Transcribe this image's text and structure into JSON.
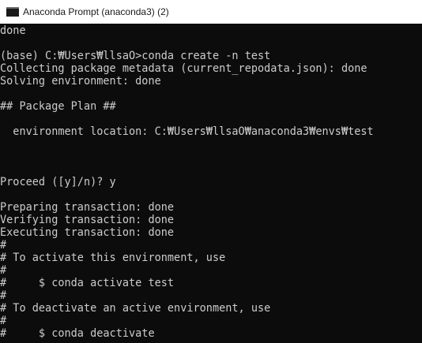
{
  "window": {
    "title": "Anaconda Prompt (anaconda3) (2)",
    "icon": "console-window-icon"
  },
  "console": {
    "colors": {
      "background": "#0c0c0c",
      "text": "#cccccc"
    },
    "lines": [
      "done",
      "",
      "(base) C:₩Users₩llsaO>conda create -n test",
      "Collecting package metadata (current_repodata.json): done",
      "Solving environment: done",
      "",
      "## Package Plan ##",
      "",
      "  environment location: C:₩Users₩llsaO₩anaconda3₩envs₩test",
      "",
      "",
      "",
      "Proceed ([y]/n)? y",
      "",
      "Preparing transaction: done",
      "Verifying transaction: done",
      "Executing transaction: done",
      "#",
      "# To activate this environment, use",
      "#",
      "#     $ conda activate test",
      "#",
      "# To deactivate an active environment, use",
      "#",
      "#     $ conda deactivate"
    ]
  }
}
